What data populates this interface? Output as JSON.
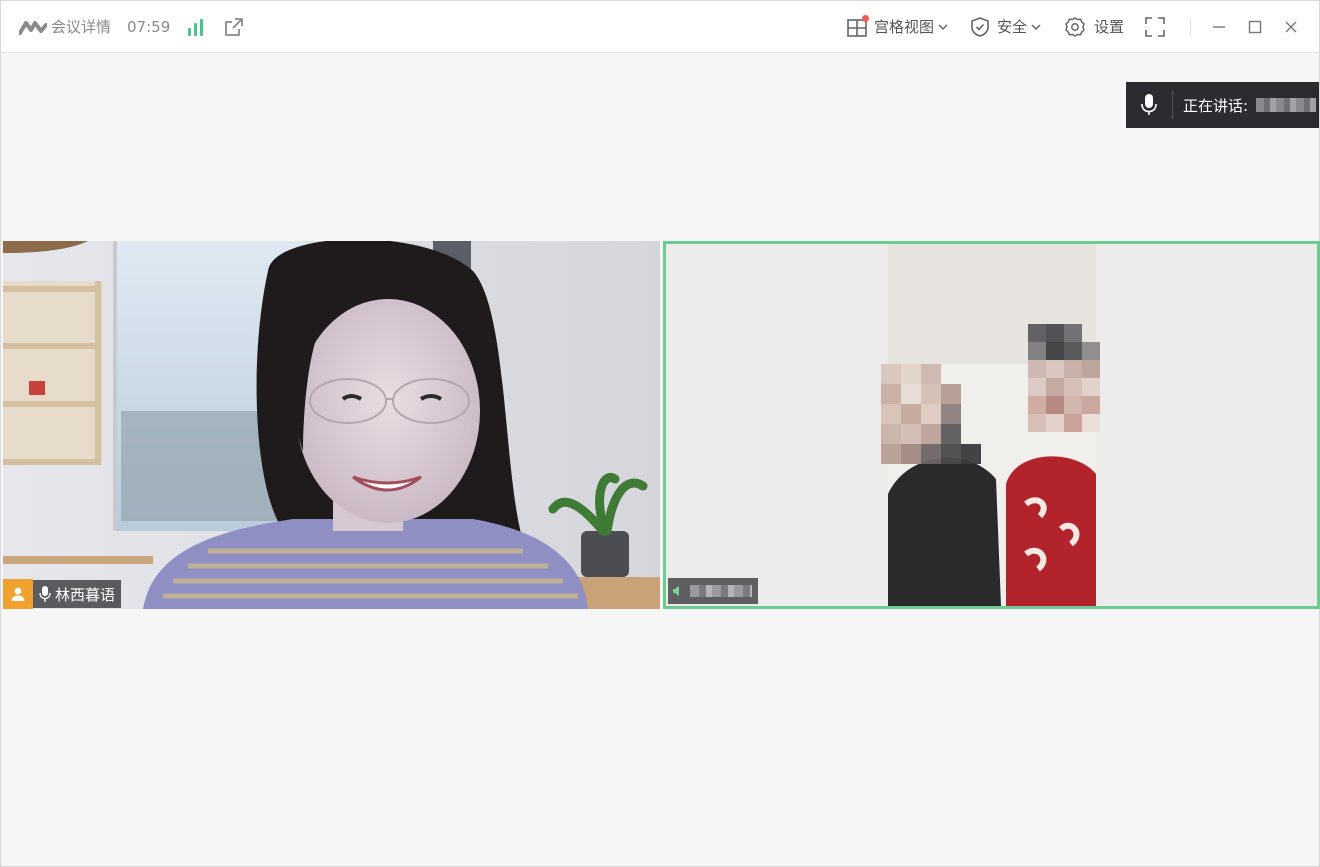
{
  "titlebar": {
    "meeting_info": "会议详情",
    "timer": "07:59",
    "grid_view_label": "宫格视图",
    "security_label": "安全",
    "settings_label": "设置"
  },
  "speaking": {
    "label": "正在讲话:"
  },
  "participants": [
    {
      "name": "林西暮语",
      "role": "host"
    },
    {
      "name": ""
    }
  ],
  "colors": {
    "active_border": "#6ccb8e",
    "host_badge": "#f0a22e",
    "signal": "#4cc38a",
    "notification_dot": "#f25a5a"
  },
  "icons": {
    "logo": "meeting-app-logo",
    "signal": "signal-bars-icon",
    "external": "external-link-icon",
    "grid": "grid-view-icon",
    "security": "shield-icon",
    "settings": "gear-icon",
    "fullscreen": "fullscreen-icon",
    "minimize": "minimize-icon",
    "maximize": "maximize-icon",
    "close": "close-icon",
    "mic": "microphone-icon",
    "host": "user-icon"
  }
}
